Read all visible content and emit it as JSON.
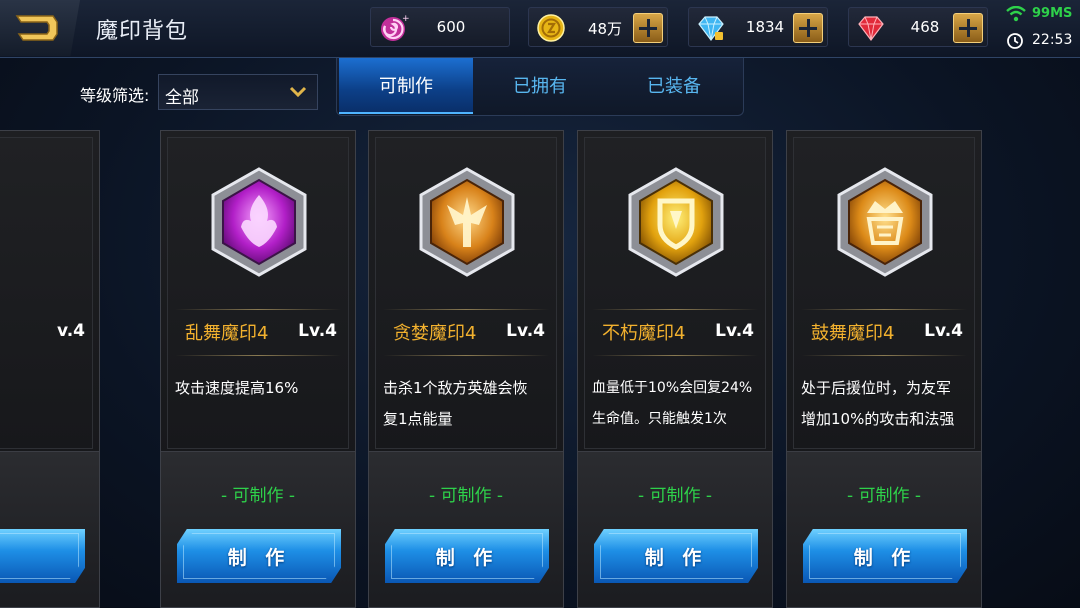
{
  "header": {
    "title": "魔印背包",
    "resources": [
      {
        "name": "swirl-currency",
        "icon": "pink-swirl-icon",
        "value": "600",
        "has_plus": false
      },
      {
        "name": "gold",
        "icon": "gold-coin-icon",
        "value": "48万",
        "has_plus": true
      },
      {
        "name": "diamond",
        "icon": "blue-diamond-icon",
        "value": "1834",
        "has_plus": true
      },
      {
        "name": "ruby",
        "icon": "red-gem-icon",
        "value": "468",
        "has_plus": true
      }
    ],
    "status": {
      "ping": "99MS",
      "time": "22:53"
    }
  },
  "filter": {
    "label": "等级筛选:",
    "value": "全部"
  },
  "tabs": [
    {
      "label": "可制作",
      "active": true
    },
    {
      "label": "已拥有",
      "active": false
    },
    {
      "label": "已装备",
      "active": false
    }
  ],
  "partial_card": {
    "level": "v.4"
  },
  "cards": [
    {
      "name": "乱舞魔印4",
      "level": "Lv.4",
      "desc": [
        "攻击速度提高16%"
      ],
      "status": "- 可制作 -",
      "button": "制 作",
      "badge_color": "purple",
      "emblem": "flame"
    },
    {
      "name": "贪婪魔印4",
      "level": "Lv.4",
      "desc": [
        "击杀1个敌方英雄会恢",
        "复1点能量"
      ],
      "status": "- 可制作 -",
      "button": "制 作",
      "badge_color": "orange",
      "emblem": "wings"
    },
    {
      "name": "不朽魔印4",
      "level": "Lv.4",
      "desc": [
        "血量低于10%会回复24%",
        "生命值。只能触发1次"
      ],
      "status": "- 可制作 -",
      "button": "制 作",
      "badge_color": "gold",
      "emblem": "shield"
    },
    {
      "name": "鼓舞魔印4",
      "level": "Lv.4",
      "desc": [
        "处于后援位时，为友军",
        "增加10%的攻击和法强"
      ],
      "status": "- 可制作 -",
      "button": "制 作",
      "badge_color": "orange",
      "emblem": "crown"
    }
  ],
  "colors": {
    "accent_blue": "#1e8fe6",
    "seal_name": "#f2b12e",
    "craftable_green": "#2ed14a",
    "ping_green": "#2ed14a"
  }
}
